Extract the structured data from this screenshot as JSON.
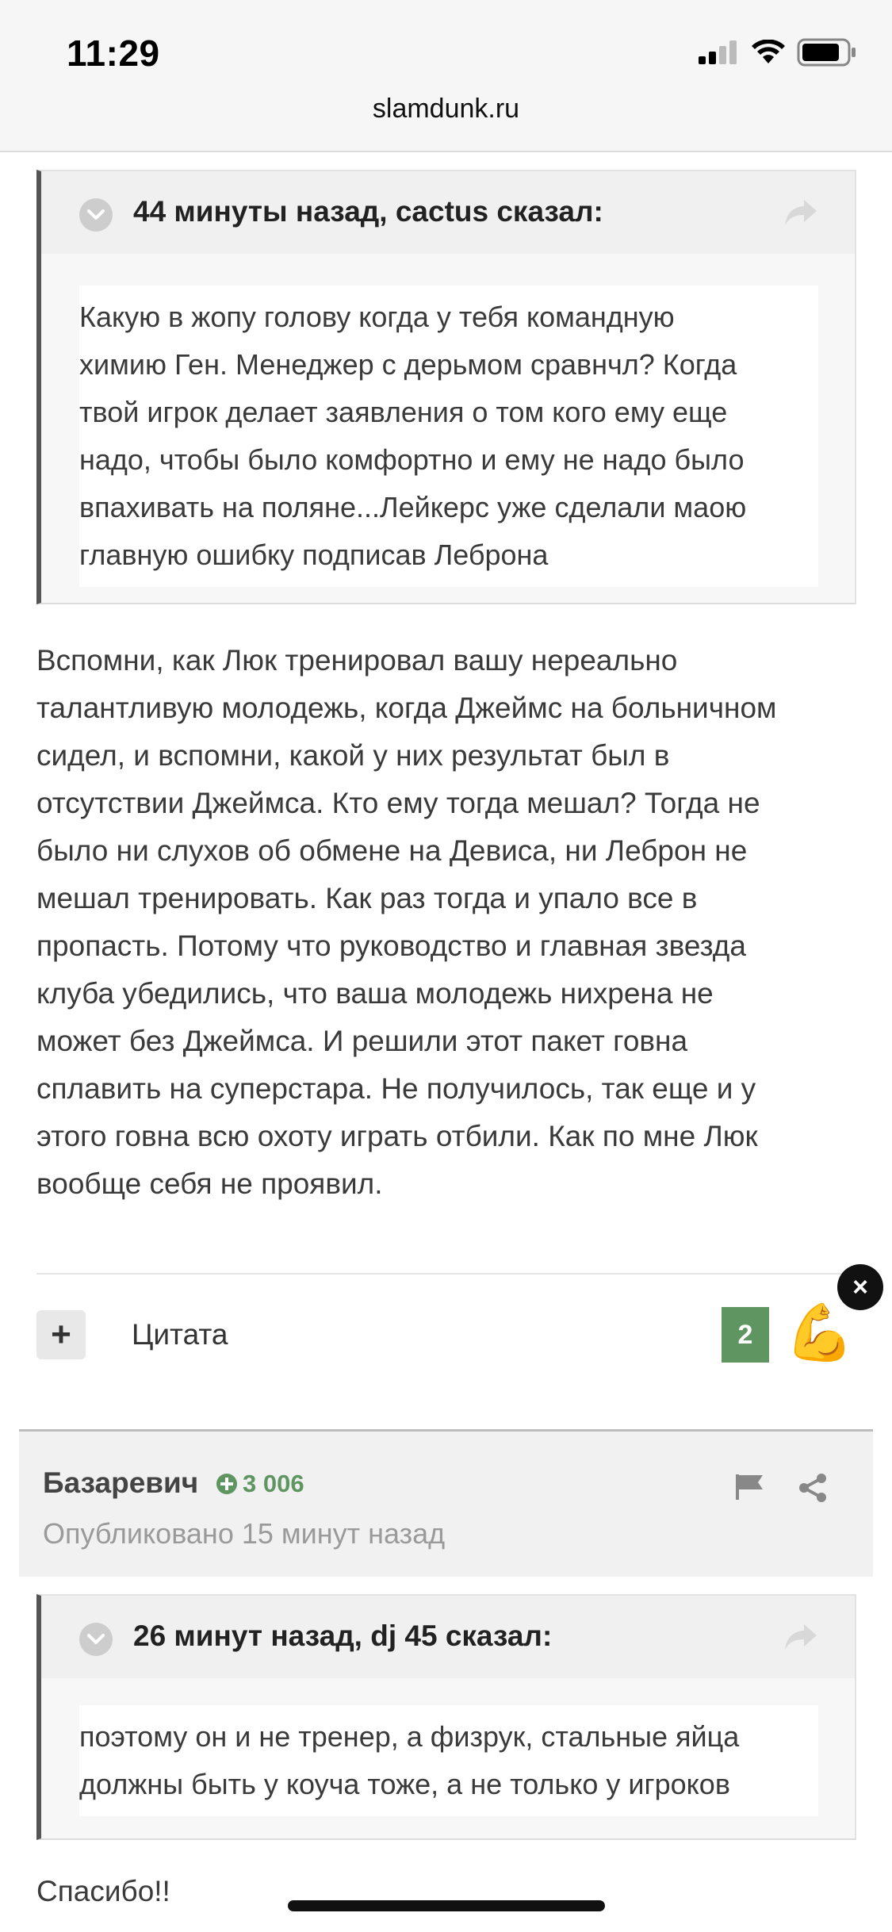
{
  "status_bar": {
    "time": "11:29"
  },
  "browser": {
    "url": "slamdunk.ru"
  },
  "quote1": {
    "citation": "44 минуты назад, cactus сказал:",
    "lines": [
      "Какую в жопу голову когда у тебя командную",
      "химию Ген. Менеджер с дерьмом сравнчл? Когда",
      "твой игрок делает заявления о том кого ему еще",
      "надо, чтобы было комфортно и ему не надо было",
      "впахивать на поляне...Лейкерс уже сделали маою",
      "главную ошибку подписав Леброна"
    ]
  },
  "post1": {
    "lines": [
      "Вспомни, как Люк тренировал вашу нереально",
      "талантливую молодежь, когда Джеймс на больничном",
      "сидел, и вспомни, какой у них результат был в",
      "отсутствии Джеймса. Кто ему тогда мешал? Тогда не",
      "было ни слухов об обмене на Девиса, ни Леброн не",
      "мешал тренировать. Как раз тогда и упало все в",
      "пропасть. Потому что руководство и главная звезда",
      "клуба убедились, что ваша молодежь нихрена не",
      "может без Джеймса. И решили этот пакет говна",
      "сплавить на суперстара. Не получилось, так еще и у",
      "этого говна всю охоту играть отбили. Как по мне Люк",
      "вообще себя не проявил."
    ],
    "actions": {
      "plus_label": "+",
      "quote_label": "Цитата",
      "reaction_count": "2",
      "reaction_emoji": "💪",
      "close_label": "×"
    }
  },
  "post2": {
    "author": "Базаревич",
    "reputation": "3 006",
    "published": "Опубликовано 15 минут назад",
    "quote": {
      "citation": "26 минут назад, dj 45 сказал:",
      "lines": [
        "поэтому он и не тренер, а физрук, стальные яйца",
        "должны быть у коуча тоже, а не только у игроков"
      ]
    },
    "text": "Спасибо!!"
  },
  "colors": {
    "reputation_green": "#5e9560",
    "quote_border": "#555555"
  }
}
